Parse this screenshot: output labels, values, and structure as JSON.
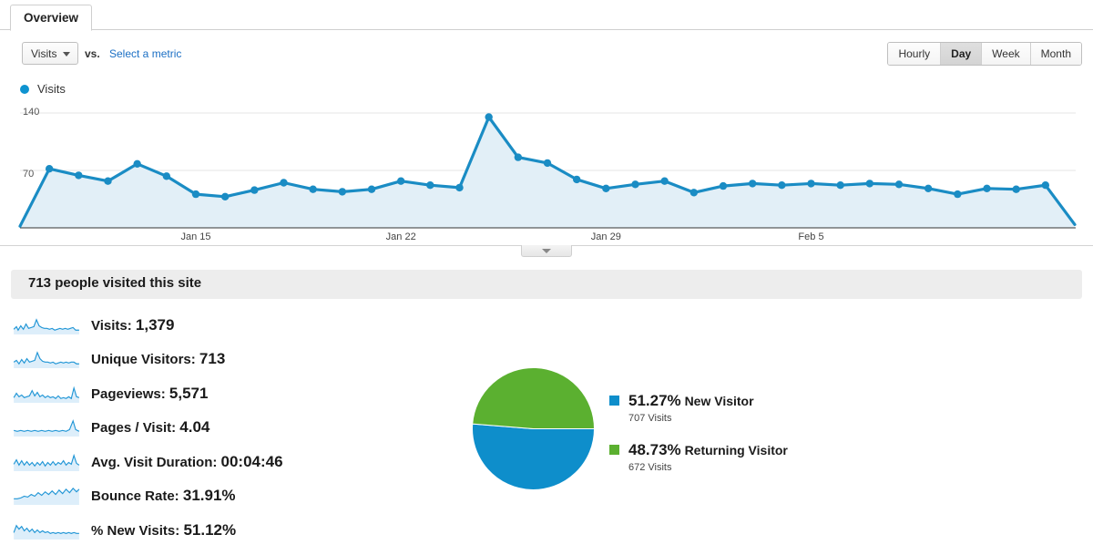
{
  "tab": {
    "label": "Overview"
  },
  "controls": {
    "metric_select": {
      "value": "Visits",
      "caret": "chevron-down-icon"
    },
    "vs_label": "vs.",
    "select_metric_link": "Select a metric",
    "granularity": [
      {
        "label": "Hourly",
        "active": false
      },
      {
        "label": "Day",
        "active": true
      },
      {
        "label": "Week",
        "active": false
      },
      {
        "label": "Month",
        "active": false
      }
    ]
  },
  "chart_legend": {
    "series_label": "Visits",
    "color": "#0e93d0"
  },
  "chart_data": {
    "type": "area",
    "title": "Visits",
    "xlabel": "",
    "ylabel": "Visits",
    "ylim": [
      0,
      140
    ],
    "yticks": [
      70,
      140
    ],
    "grid": true,
    "legend_position": "top-left",
    "line_color": "#1a8cc4",
    "fill_color": "#e2eff7",
    "x_tick_labels": [
      "Jan 15",
      "Jan 22",
      "Jan 29",
      "Feb 5"
    ],
    "x_tick_indices": [
      6,
      13,
      20,
      27
    ],
    "series": [
      {
        "name": "Visits",
        "values": [
          2,
          72,
          64,
          57,
          78,
          63,
          41,
          38,
          46,
          55,
          47,
          44,
          47,
          57,
          52,
          49,
          135,
          86,
          79,
          59,
          48,
          53,
          57,
          43,
          51,
          54,
          52,
          54,
          52,
          54,
          53,
          48,
          41,
          48,
          47,
          52,
          4
        ]
      }
    ]
  },
  "summary": {
    "title": "713 people visited this site"
  },
  "metrics": [
    {
      "label": "Visits:",
      "value": "1,379",
      "sparkline": "visits-sparkline"
    },
    {
      "label": "Unique Visitors:",
      "value": "713",
      "sparkline": "unique-visitors-sparkline"
    },
    {
      "label": "Pageviews:",
      "value": "5,571",
      "sparkline": "pageviews-sparkline"
    },
    {
      "label": "Pages / Visit:",
      "value": "4.04",
      "sparkline": "pages-per-visit-sparkline"
    },
    {
      "label": "Avg. Visit Duration:",
      "value": "00:04:46",
      "sparkline": "avg-visit-duration-sparkline"
    },
    {
      "label": "Bounce Rate:",
      "value": "31.91%",
      "sparkline": "bounce-rate-sparkline"
    },
    {
      "label": "% New Visits:",
      "value": "51.12%",
      "sparkline": "new-visits-sparkline"
    }
  ],
  "pie": {
    "type": "pie",
    "colors": {
      "new": "#0e8ecb",
      "returning": "#5bb030"
    },
    "slices": [
      {
        "label": "New Visitor",
        "percent": "51.27%",
        "percent_value": 51.27,
        "sub": "707 Visits",
        "color": "#0e8ecb"
      },
      {
        "label": "Returning Visitor",
        "percent": "48.73%",
        "percent_value": 48.73,
        "sub": "672 Visits",
        "color": "#5bb030"
      }
    ]
  },
  "sparkline_paths": {
    "visits-sparkline": "0,15 3,12 5,16 8,11 11,15 14,9 17,14 20,13 23,12 26,4 29,11 32,13 35,14 38,14 41,15 44,14 47,16 50,15 53,14 56,15 59,14 62,15 65,14 68,13 71,16 75,16",
    "unique-visitors-sparkline": "0,14 3,12 6,16 9,11 12,15 15,10 18,14 21,13 24,12 27,3 30,10 33,13 36,14 39,14 42,15 45,14 48,16 51,15 54,14 57,15 60,14 63,15 66,14 69,14 72,16 75,16",
    "pageviews-sparkline": "0,15 3,10 6,14 9,12 12,15 15,14 18,13 21,7 24,13 27,9 30,14 33,12 36,15 39,13 42,15 45,14 48,16 51,13 54,16 57,15 60,16 63,14 66,16 69,4 72,14 75,15",
    "pages-per-visit-sparkline": "0,14 4,15 8,14 12,15 16,14 20,15 24,14 28,15 32,14 36,15 40,14 44,15 48,14 52,15 56,14 60,15 64,13 68,3 71,13 75,15",
    "avg-visit-duration-sparkline": "0,13 3,8 6,14 9,9 12,14 15,10 18,14 21,11 24,15 27,11 30,14 33,10 36,15 39,11 42,14 45,10 48,14 51,11 54,13 57,9 60,14 63,11 66,13 69,3 72,12 75,14",
    "bounce-rate-sparkline": "0,14 4,14 8,13 12,11 16,12 20,9 24,11 28,7 32,10 36,6 40,9 44,5 48,9 52,4 56,8 60,3 64,7 68,2 72,6 75,3",
    "new-visits-sparkline": "0,13 3,5 6,9 9,6 12,11 15,8 18,12 21,9 24,13 27,10 30,13 33,11 36,13 39,12 42,14 45,13 48,14 51,13 54,14 57,13 60,14 63,13 66,14 69,13 72,14 75,14"
  }
}
